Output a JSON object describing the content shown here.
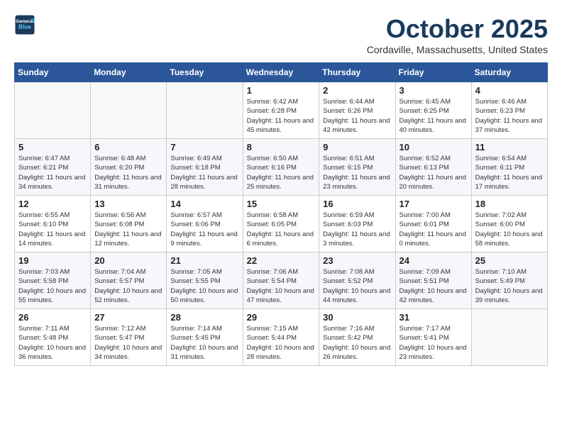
{
  "header": {
    "logo_line1": "General",
    "logo_line2": "Blue",
    "month_title": "October 2025",
    "location": "Cordaville, Massachusetts, United States"
  },
  "weekdays": [
    "Sunday",
    "Monday",
    "Tuesday",
    "Wednesday",
    "Thursday",
    "Friday",
    "Saturday"
  ],
  "weeks": [
    [
      {
        "day": "",
        "sunrise": "",
        "sunset": "",
        "daylight": ""
      },
      {
        "day": "",
        "sunrise": "",
        "sunset": "",
        "daylight": ""
      },
      {
        "day": "",
        "sunrise": "",
        "sunset": "",
        "daylight": ""
      },
      {
        "day": "1",
        "sunrise": "Sunrise: 6:42 AM",
        "sunset": "Sunset: 6:28 PM",
        "daylight": "Daylight: 11 hours and 45 minutes."
      },
      {
        "day": "2",
        "sunrise": "Sunrise: 6:44 AM",
        "sunset": "Sunset: 6:26 PM",
        "daylight": "Daylight: 11 hours and 42 minutes."
      },
      {
        "day": "3",
        "sunrise": "Sunrise: 6:45 AM",
        "sunset": "Sunset: 6:25 PM",
        "daylight": "Daylight: 11 hours and 40 minutes."
      },
      {
        "day": "4",
        "sunrise": "Sunrise: 6:46 AM",
        "sunset": "Sunset: 6:23 PM",
        "daylight": "Daylight: 11 hours and 37 minutes."
      }
    ],
    [
      {
        "day": "5",
        "sunrise": "Sunrise: 6:47 AM",
        "sunset": "Sunset: 6:21 PM",
        "daylight": "Daylight: 11 hours and 34 minutes."
      },
      {
        "day": "6",
        "sunrise": "Sunrise: 6:48 AM",
        "sunset": "Sunset: 6:20 PM",
        "daylight": "Daylight: 11 hours and 31 minutes."
      },
      {
        "day": "7",
        "sunrise": "Sunrise: 6:49 AM",
        "sunset": "Sunset: 6:18 PM",
        "daylight": "Daylight: 11 hours and 28 minutes."
      },
      {
        "day": "8",
        "sunrise": "Sunrise: 6:50 AM",
        "sunset": "Sunset: 6:16 PM",
        "daylight": "Daylight: 11 hours and 25 minutes."
      },
      {
        "day": "9",
        "sunrise": "Sunrise: 6:51 AM",
        "sunset": "Sunset: 6:15 PM",
        "daylight": "Daylight: 11 hours and 23 minutes."
      },
      {
        "day": "10",
        "sunrise": "Sunrise: 6:52 AM",
        "sunset": "Sunset: 6:13 PM",
        "daylight": "Daylight: 11 hours and 20 minutes."
      },
      {
        "day": "11",
        "sunrise": "Sunrise: 6:54 AM",
        "sunset": "Sunset: 6:11 PM",
        "daylight": "Daylight: 11 hours and 17 minutes."
      }
    ],
    [
      {
        "day": "12",
        "sunrise": "Sunrise: 6:55 AM",
        "sunset": "Sunset: 6:10 PM",
        "daylight": "Daylight: 11 hours and 14 minutes."
      },
      {
        "day": "13",
        "sunrise": "Sunrise: 6:56 AM",
        "sunset": "Sunset: 6:08 PM",
        "daylight": "Daylight: 11 hours and 12 minutes."
      },
      {
        "day": "14",
        "sunrise": "Sunrise: 6:57 AM",
        "sunset": "Sunset: 6:06 PM",
        "daylight": "Daylight: 11 hours and 9 minutes."
      },
      {
        "day": "15",
        "sunrise": "Sunrise: 6:58 AM",
        "sunset": "Sunset: 6:05 PM",
        "daylight": "Daylight: 11 hours and 6 minutes."
      },
      {
        "day": "16",
        "sunrise": "Sunrise: 6:59 AM",
        "sunset": "Sunset: 6:03 PM",
        "daylight": "Daylight: 11 hours and 3 minutes."
      },
      {
        "day": "17",
        "sunrise": "Sunrise: 7:00 AM",
        "sunset": "Sunset: 6:01 PM",
        "daylight": "Daylight: 11 hours and 0 minutes."
      },
      {
        "day": "18",
        "sunrise": "Sunrise: 7:02 AM",
        "sunset": "Sunset: 6:00 PM",
        "daylight": "Daylight: 10 hours and 58 minutes."
      }
    ],
    [
      {
        "day": "19",
        "sunrise": "Sunrise: 7:03 AM",
        "sunset": "Sunset: 5:58 PM",
        "daylight": "Daylight: 10 hours and 55 minutes."
      },
      {
        "day": "20",
        "sunrise": "Sunrise: 7:04 AM",
        "sunset": "Sunset: 5:57 PM",
        "daylight": "Daylight: 10 hours and 52 minutes."
      },
      {
        "day": "21",
        "sunrise": "Sunrise: 7:05 AM",
        "sunset": "Sunset: 5:55 PM",
        "daylight": "Daylight: 10 hours and 50 minutes."
      },
      {
        "day": "22",
        "sunrise": "Sunrise: 7:06 AM",
        "sunset": "Sunset: 5:54 PM",
        "daylight": "Daylight: 10 hours and 47 minutes."
      },
      {
        "day": "23",
        "sunrise": "Sunrise: 7:08 AM",
        "sunset": "Sunset: 5:52 PM",
        "daylight": "Daylight: 10 hours and 44 minutes."
      },
      {
        "day": "24",
        "sunrise": "Sunrise: 7:09 AM",
        "sunset": "Sunset: 5:51 PM",
        "daylight": "Daylight: 10 hours and 42 minutes."
      },
      {
        "day": "25",
        "sunrise": "Sunrise: 7:10 AM",
        "sunset": "Sunset: 5:49 PM",
        "daylight": "Daylight: 10 hours and 39 minutes."
      }
    ],
    [
      {
        "day": "26",
        "sunrise": "Sunrise: 7:11 AM",
        "sunset": "Sunset: 5:48 PM",
        "daylight": "Daylight: 10 hours and 36 minutes."
      },
      {
        "day": "27",
        "sunrise": "Sunrise: 7:12 AM",
        "sunset": "Sunset: 5:47 PM",
        "daylight": "Daylight: 10 hours and 34 minutes."
      },
      {
        "day": "28",
        "sunrise": "Sunrise: 7:14 AM",
        "sunset": "Sunset: 5:45 PM",
        "daylight": "Daylight: 10 hours and 31 minutes."
      },
      {
        "day": "29",
        "sunrise": "Sunrise: 7:15 AM",
        "sunset": "Sunset: 5:44 PM",
        "daylight": "Daylight: 10 hours and 28 minutes."
      },
      {
        "day": "30",
        "sunrise": "Sunrise: 7:16 AM",
        "sunset": "Sunset: 5:42 PM",
        "daylight": "Daylight: 10 hours and 26 minutes."
      },
      {
        "day": "31",
        "sunrise": "Sunrise: 7:17 AM",
        "sunset": "Sunset: 5:41 PM",
        "daylight": "Daylight: 10 hours and 23 minutes."
      },
      {
        "day": "",
        "sunrise": "",
        "sunset": "",
        "daylight": ""
      }
    ]
  ]
}
